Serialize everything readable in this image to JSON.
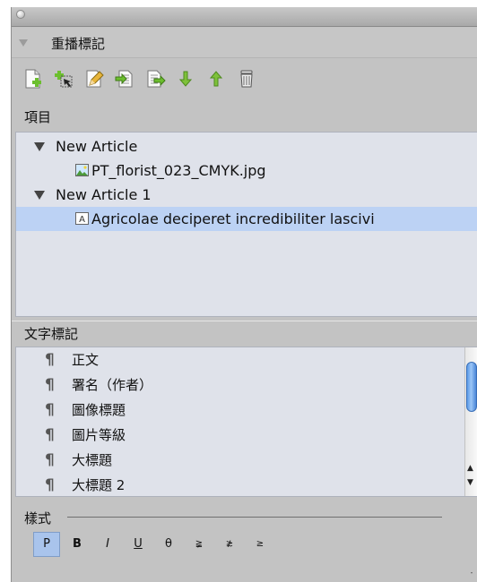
{
  "panel": {
    "title": "重播標記"
  },
  "toolbar": {
    "buttons": [
      {
        "name": "new-article-button",
        "icon": "new-document-icon"
      },
      {
        "name": "add-to-article-button",
        "icon": "add-selection-icon"
      },
      {
        "name": "edit-tag-button",
        "icon": "edit-pencil-icon"
      },
      {
        "name": "import-button",
        "icon": "import-icon"
      },
      {
        "name": "export-button",
        "icon": "export-icon"
      },
      {
        "name": "move-down-button",
        "icon": "arrow-down-icon"
      },
      {
        "name": "move-up-button",
        "icon": "arrow-up-icon"
      },
      {
        "name": "delete-button",
        "icon": "trash-icon"
      }
    ]
  },
  "items_section": {
    "label": "項目",
    "tree": [
      {
        "label": "New Article",
        "expanded": true
      },
      {
        "label": "PT_florist_023_CMYK.jpg",
        "type": "image"
      },
      {
        "label": "New Article 1",
        "expanded": true
      },
      {
        "label": "Agricolae deciperet incredibiliter lascivi",
        "type": "text",
        "selected": true
      }
    ]
  },
  "char_tags_section": {
    "label": "文字標記",
    "items": [
      "正文",
      "署名（作者）",
      "圖像標題",
      "圖片等級",
      "大標題",
      "大標題 2"
    ]
  },
  "styles_section": {
    "label": "樣式",
    "buttons": [
      "P",
      "B",
      "I",
      "U",
      "θ",
      "≩",
      "≵",
      "≥"
    ],
    "active": "P"
  },
  "colors": {
    "selection": "#bcd2f4",
    "list_bg": "#dfe2ea",
    "panel_bg": "#c3c3c3",
    "toolbar_green": "#7ec13a"
  }
}
